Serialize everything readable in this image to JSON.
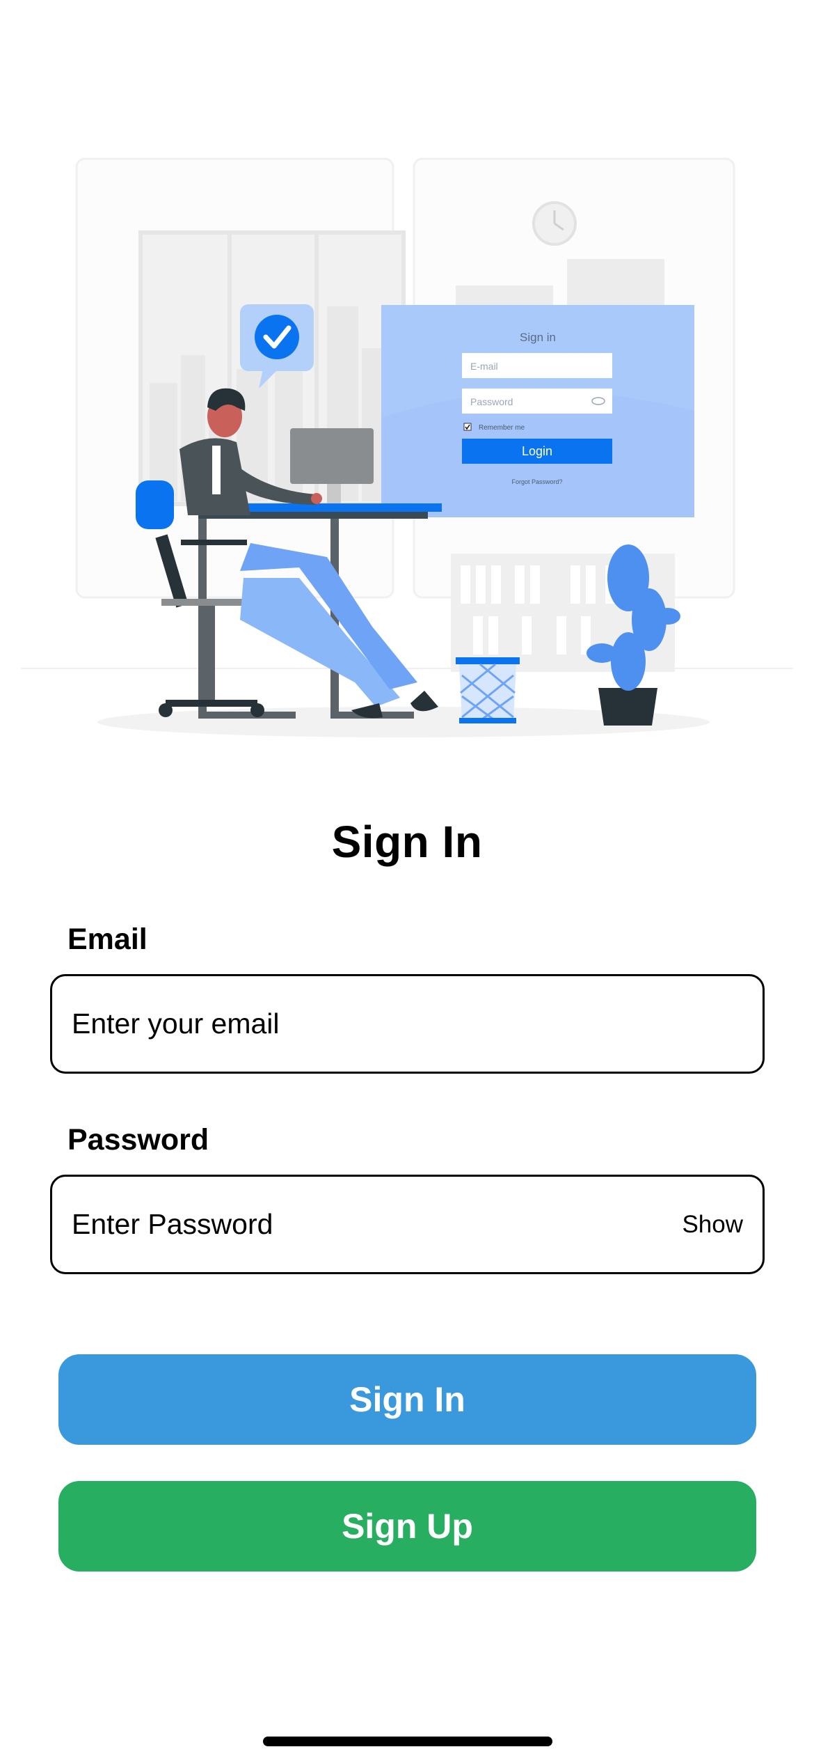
{
  "illustration": {
    "mock_title": "Sign in",
    "mock_email_placeholder": "E-mail",
    "mock_password_placeholder": "Password",
    "mock_remember": "Remember me",
    "mock_login_label": "Login",
    "mock_forgot": "Forgot Password?"
  },
  "title": "Sign In",
  "email": {
    "label": "Email",
    "placeholder": "Enter your email",
    "value": ""
  },
  "password": {
    "label": "Password",
    "placeholder": "Enter Password",
    "value": "",
    "toggle_label": "Show"
  },
  "buttons": {
    "sign_in": "Sign In",
    "sign_up": "Sign Up"
  },
  "colors": {
    "sign_in_button": "#3A99DC",
    "sign_up_button": "#27AE60",
    "text": "#000000",
    "illustration_accent": "#0A74F0"
  }
}
